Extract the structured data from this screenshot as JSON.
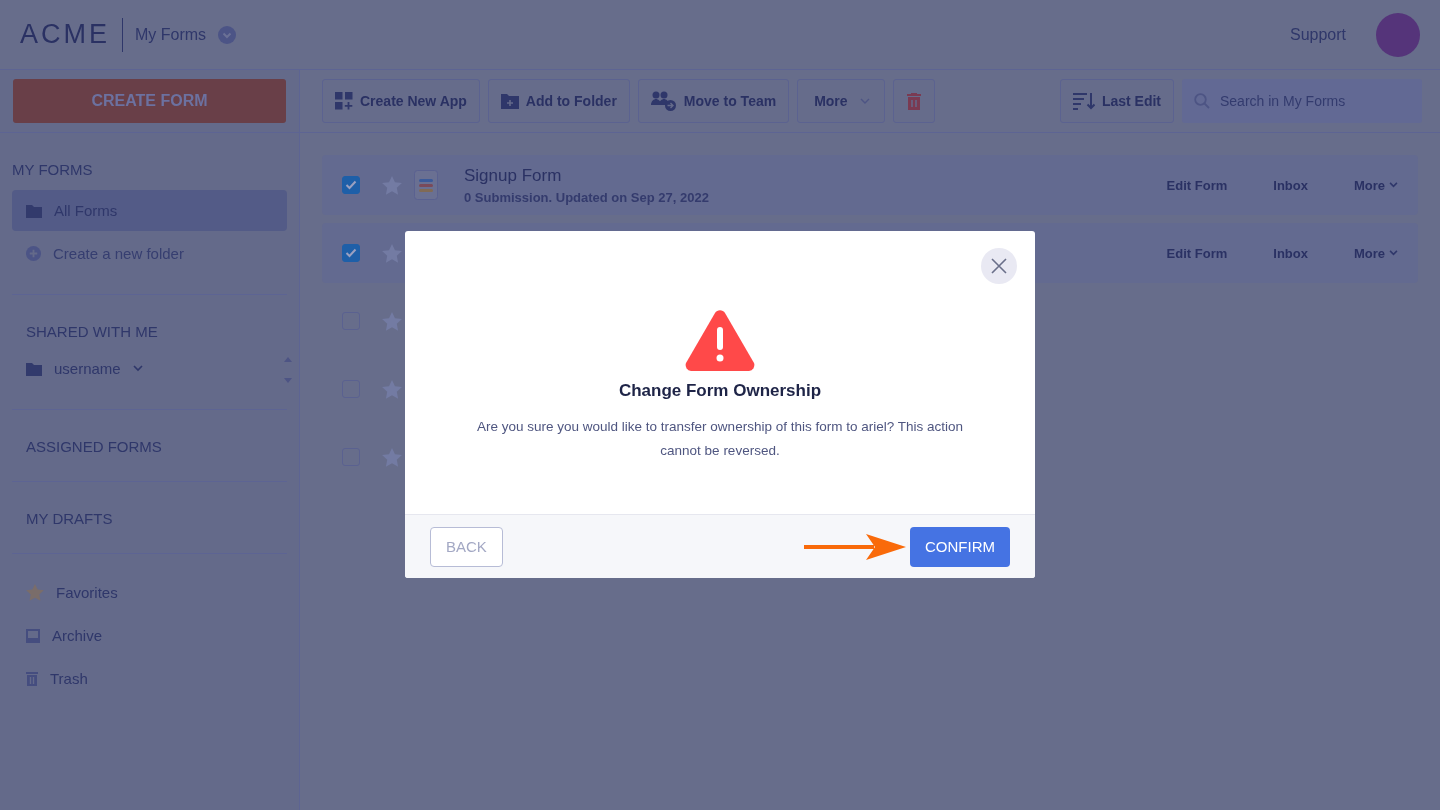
{
  "header": {
    "logo": "ACME",
    "workspace": "My Forms",
    "support": "Support"
  },
  "toolbar": {
    "create": "CREATE FORM",
    "buttons": [
      {
        "kind": "apps",
        "label": "Create New App"
      },
      {
        "kind": "folder",
        "label": "Add to Folder"
      },
      {
        "kind": "team",
        "label": "Move to Team"
      },
      {
        "kind": "more",
        "label": "More"
      },
      {
        "kind": "delete"
      }
    ],
    "sort": "Last Edit",
    "search_placeholder": "Search in My Forms"
  },
  "sidebar": {
    "sections": [
      {
        "heading": "MY FORMS",
        "items": [
          {
            "kind": "folder",
            "label": "All Forms",
            "selected": true
          },
          {
            "kind": "add",
            "label": "Create a new folder",
            "selected": false
          }
        ]
      },
      {
        "heading": "SHARED WITH ME",
        "items": [
          {
            "kind": "user-folder",
            "label": "username",
            "selected": false
          }
        ]
      },
      {
        "heading": "ASSIGNED FORMS"
      },
      {
        "heading": "MY DRAFTS"
      },
      {
        "items": [
          {
            "kind": "star",
            "label": "Favorites",
            "selected": false
          },
          {
            "kind": "archive",
            "label": "Archive",
            "selected": false
          },
          {
            "kind": "trash",
            "label": "Trash",
            "selected": false
          }
        ]
      }
    ]
  },
  "forms": [
    {
      "checked": true,
      "name": "Signup Form",
      "meta": "0 Submission. Updated on Sep 27, 2022",
      "actions": [
        "Edit Form",
        "Inbox",
        "More"
      ]
    },
    {
      "checked": true,
      "actions": [
        "Edit Form",
        "Inbox",
        "More"
      ]
    },
    {
      "checked": false
    },
    {
      "checked": false
    },
    {
      "checked": false
    }
  ],
  "dialog": {
    "title": "Change Form Ownership",
    "message": "Are you sure you would like to transfer ownership of this form to ariel? This action cannot be reversed.",
    "back": "BACK",
    "confirm": "CONFIRM"
  }
}
